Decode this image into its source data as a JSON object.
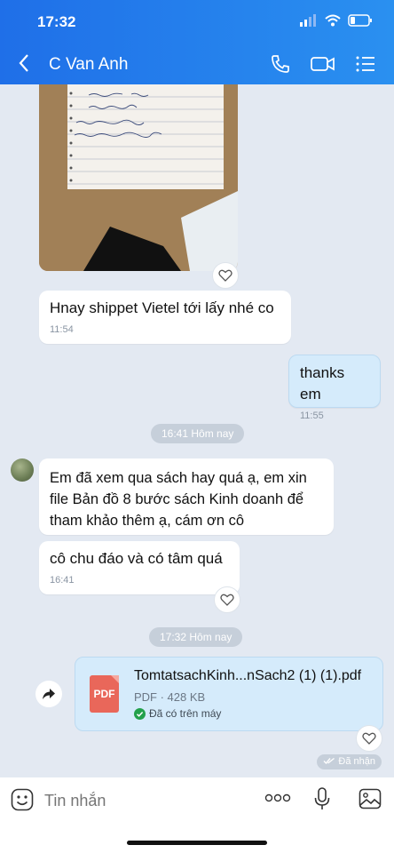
{
  "status": {
    "time": "17:32"
  },
  "header": {
    "contact_name": "C Van Anh"
  },
  "messages": [
    {
      "text": "Hnay shippet Vietel tới lấy nhé co",
      "time": "11:54"
    },
    {
      "text": "thanks em",
      "time": "11:55"
    },
    {
      "text": "Em đã xem qua sách hay quá ạ, em xin file Bản đồ 8 bước sách Kinh doanh để tham khảo thêm ạ, cám ơn cô"
    },
    {
      "text": "cô chu đáo và có tâm quá",
      "time": "16:41"
    }
  ],
  "separators": [
    "16:41 Hôm nay",
    "17:32 Hôm nay"
  ],
  "file": {
    "name": "TomtatsachKinh...nSach2 (1) (1).pdf",
    "meta": "PDF · 428 KB",
    "status": "Đã có trên máy",
    "icon_label": "PDF"
  },
  "received_label": "Đã nhận",
  "composer": {
    "placeholder": "Tin nhắn"
  },
  "colors": {
    "header": "#2180ec",
    "mine_bubble": "#d5ebfb",
    "background": "#e3e9f2"
  }
}
